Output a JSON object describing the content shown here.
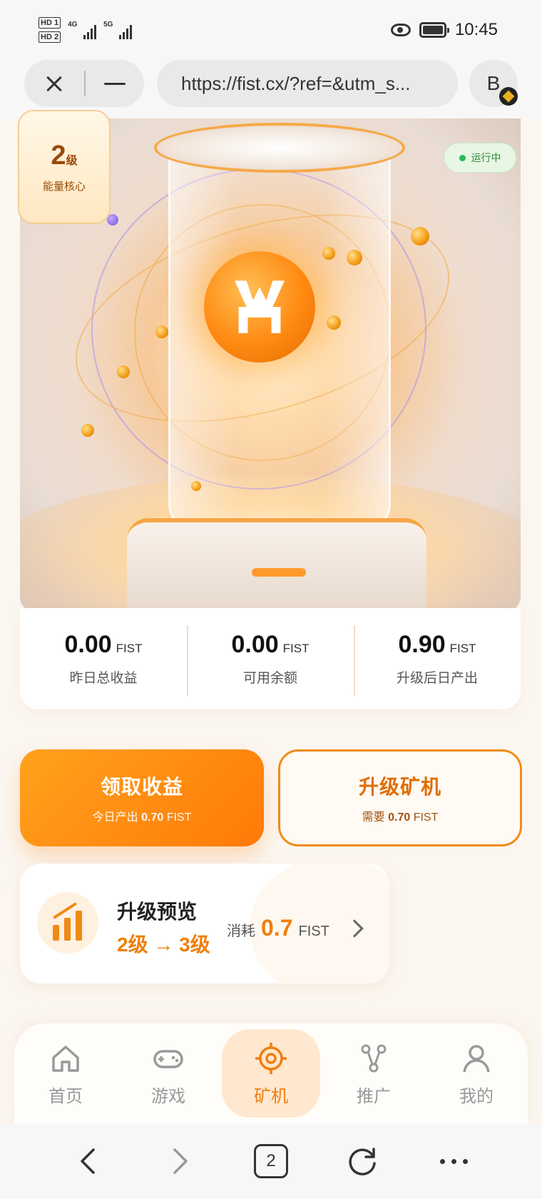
{
  "status_bar": {
    "sim1": "HD 1",
    "sim2": "HD 2",
    "net1": "4G",
    "net2": "5G",
    "time": "10:45"
  },
  "browser": {
    "url": "https://fist.cx/?ref=&utm_s...",
    "account_initial": "B"
  },
  "hero": {
    "level_value": "2",
    "level_unit": "级",
    "level_label": "能量核心",
    "status": "运行中",
    "accent": "#ff8a12"
  },
  "stats": [
    {
      "value": "0.00",
      "unit": "FIST",
      "label": "昨日总收益"
    },
    {
      "value": "0.00",
      "unit": "FIST",
      "label": "可用余额"
    },
    {
      "value": "0.90",
      "unit": "FIST",
      "label": "升级后日产出"
    }
  ],
  "actions": {
    "claim": {
      "title": "领取收益",
      "sub_prefix": "今日产出",
      "sub_value": "0.70",
      "sub_unit": "FIST"
    },
    "upgrade": {
      "title": "升级矿机",
      "sub_prefix": "需要",
      "sub_value": "0.70",
      "sub_unit": "FIST"
    }
  },
  "preview": {
    "title": "升级预览",
    "levels": "2级 → 3级",
    "cost_label": "消耗",
    "cost_value": "0.7",
    "cost_unit": "FIST"
  },
  "tabs": [
    {
      "label": "首页",
      "icon": "home-icon",
      "active": false
    },
    {
      "label": "游戏",
      "icon": "gamepad-icon",
      "active": false
    },
    {
      "label": "矿机",
      "icon": "target-icon",
      "active": true
    },
    {
      "label": "推广",
      "icon": "share-icon",
      "active": false
    },
    {
      "label": "我的",
      "icon": "user-icon",
      "active": false
    }
  ],
  "browser_nav": {
    "tab_count": "2"
  }
}
